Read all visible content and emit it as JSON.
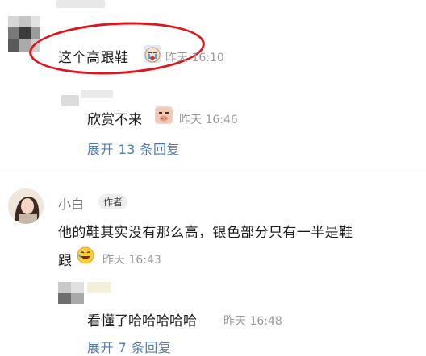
{
  "comment1": {
    "text": "这个高跟鞋",
    "emoji": "crying-emoji",
    "time": "昨天 16:10"
  },
  "reply1": {
    "text": "欣赏不来",
    "emoji": "pig-emoji",
    "time": "昨天 16:46"
  },
  "expand1": {
    "label": "展开 13 条回复"
  },
  "comment2": {
    "author": "小白",
    "badge": "作者",
    "line1": "他的鞋其实没有那么高，银色部分只有一半是鞋",
    "line2": "跟",
    "emoji": "laughing-emoji",
    "time": "昨天 16:43"
  },
  "reply2": {
    "text": "看懂了哈哈哈哈哈",
    "time": "昨天 16:48"
  },
  "expand2": {
    "label": "展开 7 条回复"
  },
  "colors": {
    "link": "#4e7cb8",
    "highlight": "#e0141b",
    "meta": "#9a9a9a"
  }
}
